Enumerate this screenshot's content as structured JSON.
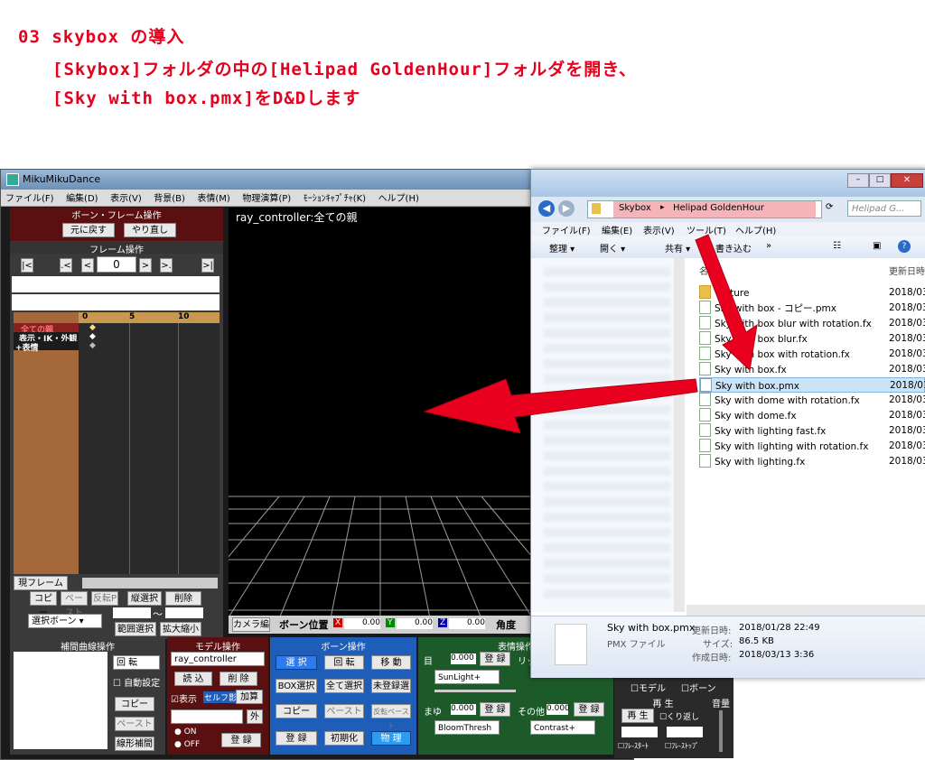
{
  "heading": {
    "line1": "03 skybox の導入",
    "line2": "[Skybox]フォルダの中の[Helipad GoldenHour]フォルダを開き、",
    "line3": "[Sky with box.pmx]をD&Dします"
  },
  "mmd": {
    "title": "MikuMikuDance",
    "menu": [
      "ファイル(F)",
      "編集(D)",
      "表示(V)",
      "背景(B)",
      "表情(M)",
      "物理演算(P)",
      "ﾓｰｼｮﾝｷｬﾌﾟﾁｬ(K)",
      "ヘルプ(H)"
    ],
    "bone_frame_header": "ボーン・フレーム操作",
    "undo": "元に戻す",
    "redo": "やり直し",
    "frame_op": "フレーム操作",
    "frame_value": "0",
    "timeline_ticks": [
      "0",
      "5",
      "10"
    ],
    "tracks": [
      "全ての親",
      "表示・IK・外観",
      "+表情"
    ],
    "current_frame_btn": "現フレーム",
    "copy": "コピー",
    "paste": "ペースト",
    "reverse_paste": "反転P",
    "vert_select": "縦選択",
    "delete": "削除",
    "select_bone": "選択ボーン",
    "range_select": "範囲選択",
    "expand": "拡大縮小",
    "tilde": "～",
    "viewport_title": "ray_controller:全ての親",
    "camera_edit": "カメラ編",
    "bone_pos_label": "ボーン位置",
    "x_label": "X",
    "x_val": "0.00",
    "y_label": "Y",
    "y_val": "0.00",
    "z_label": "Z",
    "z_val": "0.00",
    "angle_label": "角度",
    "interp_header": "補間曲線操作",
    "rotate": "回 転",
    "auto_set": "自動設定",
    "copy2": "コピー",
    "paste2": "ペースト",
    "linear": "線形補間",
    "model_header": "モデル操作",
    "model_select": "ray_controller",
    "load": "読 込",
    "delete2": "削 除",
    "display": "表示",
    "self_shadow": "セルフ影",
    "add": "加算",
    "outside": "外",
    "on": "ON",
    "off": "OFF",
    "register": "登 録",
    "bone_op_header": "ボーン操作",
    "select": "選 択",
    "rotate2": "回 転",
    "move": "移 動",
    "box_select": "BOX選択",
    "select_all": "全て選択",
    "unregistered": "未登録選",
    "copy3": "コピー",
    "paste3": "ペースト",
    "reverse_paste2": "反転ペースト",
    "register2": "登 録",
    "init": "初期化",
    "physics": "物 理",
    "face_header": "表情操作",
    "eye_label": "目",
    "eye_val": "0.000",
    "register_f": "登 録",
    "lip_label": "リッ",
    "sunlight": "SunLight+",
    "brow_label": "まゆ",
    "brow_val": "0.000",
    "other_label": "その他",
    "other_val": "0.000",
    "bloom": "BloomThresh",
    "contrast": "Contrast+",
    "model_chk": "モデル",
    "bone_chk": "ボーン",
    "play_header": "再 生",
    "play": "再 生",
    "repeat": "くり返し",
    "frame_start": "ﾌﾚ-ｽﾀｰﾄ",
    "frame_stop": "ﾌﾚ-ｽﾄｯﾌﾟ",
    "volume": "音量"
  },
  "explorer": {
    "breadcrumb": [
      "Skybox",
      "Helipad GoldenHour"
    ],
    "search_placeholder": "Helipad G...",
    "menu": [
      "ファイル(F)",
      "編集(E)",
      "表示(V)",
      "ツール(T)",
      "ヘルプ(H)"
    ],
    "toolbar": [
      "整理 ▾",
      "開く ▾",
      "共有 ▾",
      "書き込む",
      "»"
    ],
    "col_name": "名前",
    "col_date": "更新日時",
    "files": [
      {
        "name": "Texture",
        "date": "2018/03"
      },
      {
        "name": "Sky with box - コピー.pmx",
        "date": "2018/03"
      },
      {
        "name": "Sky with box blur with rotation.fx",
        "date": "2018/03"
      },
      {
        "name": "Sky with box blur.fx",
        "date": "2018/03"
      },
      {
        "name": "Sky with box with rotation.fx",
        "date": "2018/03"
      },
      {
        "name": "Sky with box.fx",
        "date": "2018/03"
      },
      {
        "name": "Sky with box.pmx",
        "date": "2018/01"
      },
      {
        "name": "Sky with dome with rotation.fx",
        "date": "2018/03"
      },
      {
        "name": "Sky with dome.fx",
        "date": "2018/03"
      },
      {
        "name": "Sky with lighting fast.fx",
        "date": "2018/03"
      },
      {
        "name": "Sky with lighting with rotation.fx",
        "date": "2018/03"
      },
      {
        "name": "Sky with lighting.fx",
        "date": "2018/03"
      }
    ],
    "details": {
      "name": "Sky with box.pmx",
      "type": "PMX ファイル",
      "modified_label": "更新日時:",
      "modified": "2018/01/28 22:49",
      "size_label": "サイズ:",
      "size": "86.5 KB",
      "created_label": "作成日時:",
      "created": "2018/03/13 3:36"
    }
  },
  "colors": {
    "accent": "#e8001e",
    "mmd_panel": "#5a1010",
    "explorer_selection": "#cce4f7"
  }
}
